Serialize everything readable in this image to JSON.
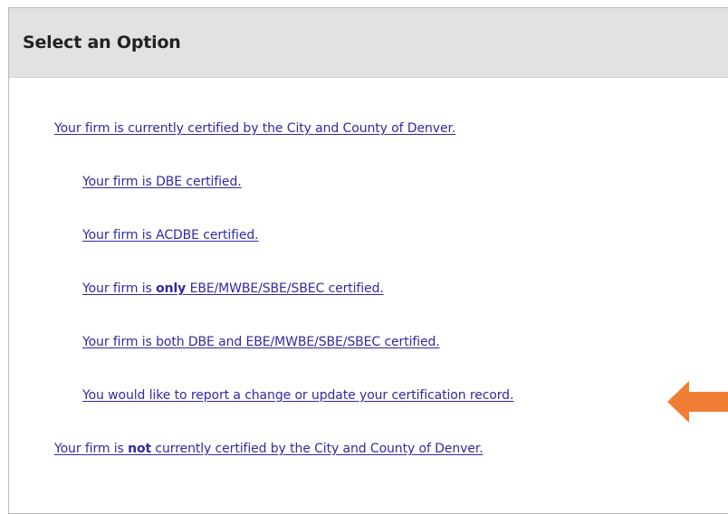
{
  "panel": {
    "title": "Select an Option"
  },
  "options": [
    {
      "level": 1,
      "text": "Your firm is currently certified by the City and County of Denver."
    },
    {
      "level": 2,
      "text": "Your firm is DBE certified."
    },
    {
      "level": 2,
      "text": "Your firm is ACDBE certified."
    },
    {
      "level": 2,
      "prefix": "Your firm is ",
      "emphasis": "only",
      "suffix": " EBE/MWBE/SBE/SBEC certified."
    },
    {
      "level": 2,
      "text": "Your firm is both DBE and EBE/MWBE/SBE/SBEC certified."
    },
    {
      "level": 2,
      "text": "You would like to report a change or update your certification record."
    },
    {
      "level": 1,
      "prefix": "Your firm is ",
      "emphasis": "not",
      "suffix": " currently certified by the City and County of Denver."
    }
  ],
  "annotation": {
    "icon": "arrow-left-icon",
    "color": "#ef7d34",
    "points_to_option": 5
  },
  "colors": {
    "link": "#2f2ba3",
    "header_bg": "#e2e2e2",
    "border": "#b9b9b9"
  }
}
